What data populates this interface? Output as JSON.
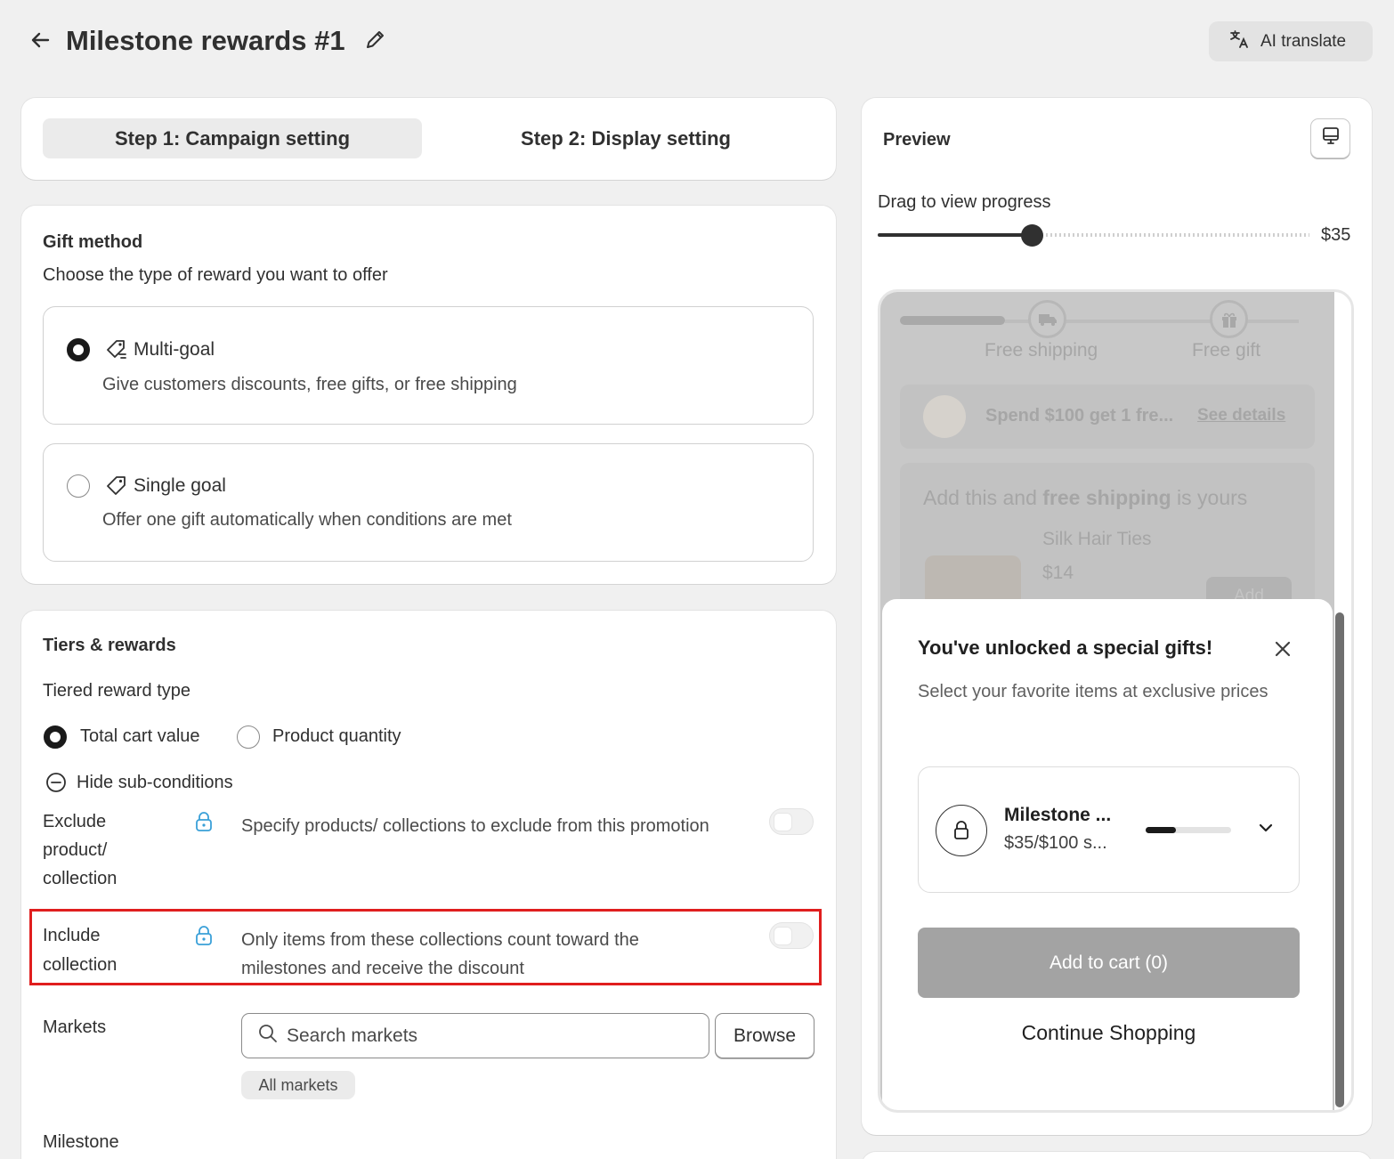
{
  "header": {
    "title": "Milestone rewards #1",
    "ai_translate": "AI translate"
  },
  "steps": {
    "step1": "Step 1: Campaign setting",
    "step2": "Step 2: Display setting"
  },
  "gift_method": {
    "title": "Gift method",
    "description": "Choose the type of reward you want to offer",
    "options": [
      {
        "label": "Multi-goal",
        "description": "Give customers discounts, free gifts, or free shipping",
        "selected": true
      },
      {
        "label": "Single goal",
        "description": "Offer one gift automatically when conditions are met",
        "selected": false
      }
    ]
  },
  "tiers": {
    "title": "Tiers & rewards",
    "reward_type_label": "Tiered reward type",
    "reward_types": [
      {
        "label": "Total cart value",
        "selected": true
      },
      {
        "label": "Product quantity",
        "selected": false
      }
    ],
    "hide_sub_conditions": "Hide sub-conditions",
    "exclude": {
      "label_line1": "Exclude",
      "label_line2": "product/",
      "label_line3": "collection",
      "description": "Specify products/ collections to exclude from this promotion",
      "enabled": false
    },
    "include": {
      "label_line1": "Include",
      "label_line2": "collection",
      "description": "Only items from these collections count toward the milestones and receive the discount",
      "enabled": false
    },
    "markets": {
      "label": "Markets",
      "search_placeholder": "Search markets",
      "browse": "Browse",
      "chip": "All markets"
    },
    "milestone_label": "Milestone"
  },
  "preview": {
    "title": "Preview",
    "drag_label": "Drag to view progress",
    "slider_value": "$35",
    "slider_fraction": 0.36,
    "background": {
      "free_shipping": "Free shipping",
      "free_gift": "Free gift",
      "promo_text": "Spend $100 get 1 fre...",
      "see_details": "See details",
      "upsell_prefix": "Add this and ",
      "upsell_bold": "free shipping",
      "upsell_suffix": " is yours",
      "product_name": "Silk Hair Ties",
      "product_price": "$14",
      "add_btn": "Add"
    },
    "modal": {
      "title": "You've unlocked a special gifts!",
      "description": "Select your favorite items at exclusive prices",
      "milestone_name": "Milestone ...",
      "milestone_sub": "$35/$100 s...",
      "milestone_progress": 0.35,
      "add_to_cart": "Add to cart (0)",
      "continue": "Continue Shopping"
    }
  }
}
